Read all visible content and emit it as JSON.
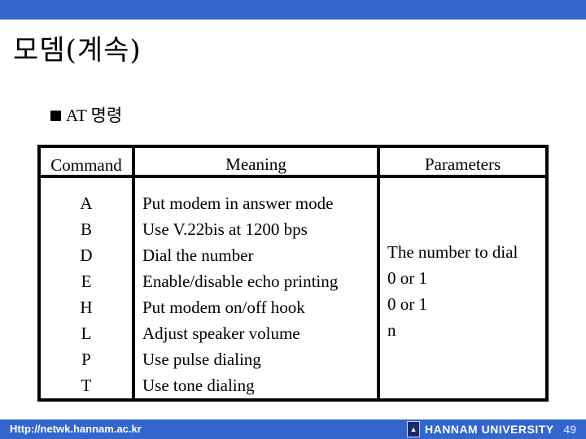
{
  "slide": {
    "title": "모뎀(계속)",
    "bullet": "AT 명령"
  },
  "table": {
    "headers": {
      "command": "Command",
      "meaning": "Meaning",
      "parameters": "Parameters"
    },
    "rows": [
      {
        "command": "A",
        "meaning": "Put modem in answer mode"
      },
      {
        "command": "B",
        "meaning": "Use V.22bis at 1200 bps"
      },
      {
        "command": "D",
        "meaning": "Dial the number"
      },
      {
        "command": "E",
        "meaning": "Enable/disable echo printing"
      },
      {
        "command": "H",
        "meaning": "Put modem on/off hook"
      },
      {
        "command": "L",
        "meaning": "Adjust speaker volume"
      },
      {
        "command": "P",
        "meaning": "Use pulse dialing"
      },
      {
        "command": "T",
        "meaning": "Use tone dialing"
      }
    ],
    "parameters": [
      "The number to dial",
      "0 or 1",
      "0 or 1",
      "n"
    ]
  },
  "footer": {
    "url": "Http://netwk.hannam.ac.kr",
    "logo_icon": "university-shield-icon",
    "university": "HANNAM  UNIVERSITY",
    "page_number": "49"
  },
  "colors": {
    "bar": "#3366CC"
  }
}
